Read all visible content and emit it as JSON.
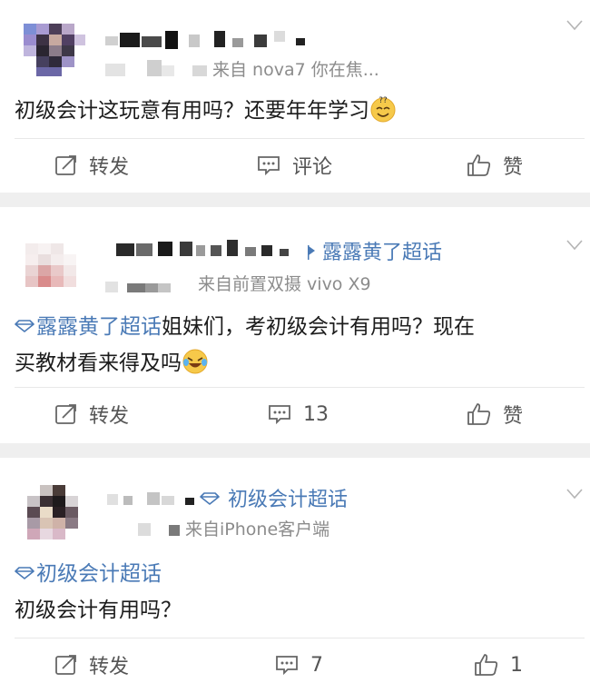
{
  "posts": [
    {
      "source": "来自 nova7 你在焦...",
      "content": "初级会计这玩意有用吗？还要年年学习",
      "emoji": "dizzy-smile-emoji",
      "actions": {
        "repost": "转发",
        "comment": "评论",
        "like": "赞"
      }
    },
    {
      "topic_tag": "露露黄了超话",
      "source": "来自前置双摄 vivo X9",
      "content_tag": "露露黄了超话",
      "content_line1": "姐妹们，考初级会计有用吗？现在",
      "content_line2": "买教材看来得及吗",
      "emoji": "crying-laughing-emoji",
      "actions": {
        "repost": "转发",
        "comment": "13",
        "like": "赞"
      }
    },
    {
      "topic_tag": "初级会计超话",
      "source": "来自iPhone客户端",
      "content_tag": "初级会计超话",
      "content": "初级会计有用吗？",
      "actions": {
        "repost": "转发",
        "comment": "7",
        "like": "1"
      }
    }
  ],
  "colors": {
    "link": "#4a7ab6",
    "meta": "#8c8c8c",
    "separator": "#efefef"
  }
}
